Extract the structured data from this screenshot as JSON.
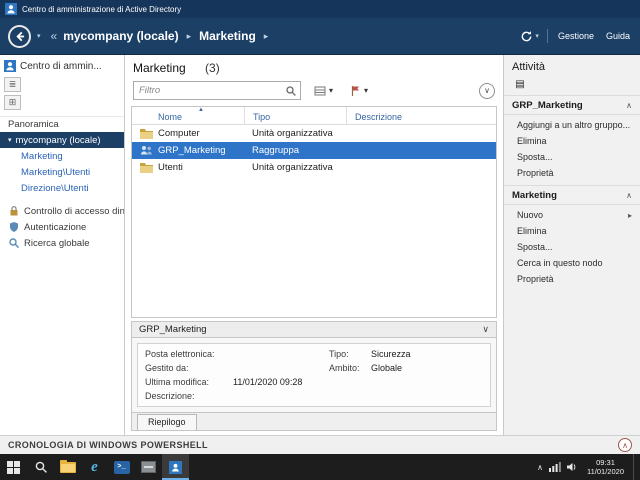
{
  "window": {
    "title": "Centro di amministrazione di Active Directory"
  },
  "nav": {
    "breadcrumb": {
      "root": "mycompany (locale)",
      "current": "Marketing"
    },
    "menu": {
      "manage": "Gestione",
      "help": "Guida"
    }
  },
  "sidebar": {
    "header": "Centro di ammin...",
    "items": [
      {
        "label": "Panoramica"
      },
      {
        "label": "mycompany (locale)"
      },
      {
        "label": "Marketing"
      },
      {
        "label": "Marketing\\Utenti"
      },
      {
        "label": "Direzione\\Utenti"
      },
      {
        "label": "Controllo di accesso dina..."
      },
      {
        "label": "Autenticazione"
      },
      {
        "label": "Ricerca globale"
      }
    ]
  },
  "main": {
    "title": "Marketing",
    "count": "(3)",
    "filter_placeholder": "Filtro",
    "columns": {
      "name": "Nome",
      "type": "Tipo",
      "description": "Descrizione"
    },
    "rows": [
      {
        "name": "Computer",
        "type": "Unità organizzativa",
        "description": ""
      },
      {
        "name": "GRP_Marketing",
        "type": "Raggruppa",
        "description": ""
      },
      {
        "name": "Utenti",
        "type": "Unità organizzativa",
        "description": ""
      }
    ],
    "details": {
      "title": "GRP_Marketing",
      "fields": {
        "email_label": "Posta elettronica:",
        "managed_by_label": "Gestito da:",
        "last_modified_label": "Ultima modifica:",
        "last_modified_value": "11/01/2020 09:28",
        "description_label": "Descrizione:",
        "type_label": "Tipo:",
        "type_value": "Sicurezza",
        "scope_label": "Ambito:",
        "scope_value": "Globale"
      },
      "tab": "Riepilogo"
    }
  },
  "tasks": {
    "title": "Attività",
    "sections": [
      {
        "header": "GRP_Marketing",
        "items": [
          {
            "label": "Aggiungi a un altro gruppo..."
          },
          {
            "label": "Elimina"
          },
          {
            "label": "Sposta..."
          },
          {
            "label": "Proprietà"
          }
        ]
      },
      {
        "header": "Marketing",
        "items": [
          {
            "label": "Nuovo"
          },
          {
            "label": "Elimina"
          },
          {
            "label": "Sposta..."
          },
          {
            "label": "Cerca in questo nodo"
          },
          {
            "label": "Proprietà"
          }
        ]
      }
    ]
  },
  "powershell_bar": {
    "label": "CRONOLOGIA DI WINDOWS POWERSHELL"
  },
  "taskbar": {
    "clock": {
      "time": "09:31",
      "date": "11/01/2020"
    }
  },
  "icons": {
    "history_dropdown": "▾",
    "breadcrumb_levels": "«",
    "breadcrumb_sep": "▸",
    "dropdown": "▾",
    "sort_asc": "▲",
    "collapse": "∧",
    "expand": "∨",
    "submenu": "▸",
    "tree_expander": "▾",
    "list_view": "≣",
    "tree_view": "⊞",
    "tasks_tool": "▤",
    "tray_chevron": "∧",
    "ps_glyph": ">_"
  },
  "colors": {
    "titlebar": "#16355a",
    "navbar": "#1c3f66",
    "selection": "#2e74c9",
    "link": "#2a64b5",
    "taskbar": "#1d1d1d"
  }
}
